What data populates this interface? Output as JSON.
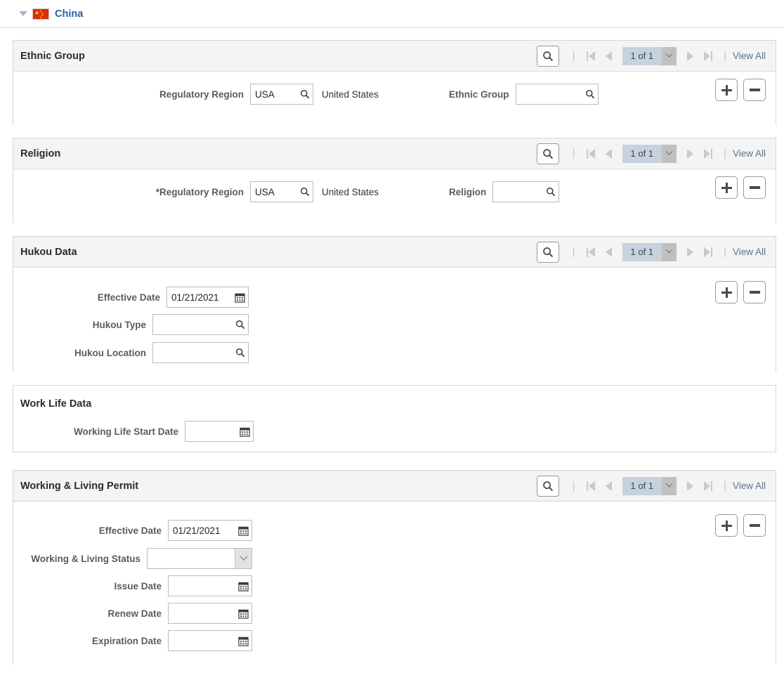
{
  "country_header": {
    "name": "China",
    "collapse_icon": "triangle-down-icon",
    "flag_icon": "china-flag-icon"
  },
  "nav_controls": {
    "search_icon": "search-icon",
    "first_icon": "first-page-icon",
    "prev_icon": "previous-page-icon",
    "next_icon": "next-page-icon",
    "last_icon": "last-page-icon",
    "counter": "1 of 1",
    "dropdown_icon": "chevron-down-icon",
    "view_all": "View All",
    "separator": "|",
    "add_icon": "plus-icon",
    "delete_icon": "minus-icon"
  },
  "sections": {
    "ethnic_group": {
      "title": "Ethnic Group",
      "counter": "1 of 1",
      "view_all": "View All",
      "regulatory_region_label": "Regulatory Region",
      "regulatory_region_value": "USA",
      "regulatory_region_description": "United States",
      "ethnic_group_label": "Ethnic Group",
      "ethnic_group_value": ""
    },
    "religion": {
      "title": "Religion",
      "counter": "1 of 1",
      "view_all": "View All",
      "regulatory_region_label": "*Regulatory Region",
      "regulatory_region_value": "USA",
      "regulatory_region_description": "United States",
      "religion_label": "Religion",
      "religion_value": ""
    },
    "hukou_data": {
      "title": "Hukou Data",
      "counter": "1 of 1",
      "view_all": "View All",
      "effective_date_label": "Effective Date",
      "effective_date_value": "01/21/2021",
      "hukou_type_label": "Hukou Type",
      "hukou_type_value": "",
      "hukou_location_label": "Hukou Location",
      "hukou_location_value": ""
    },
    "work_life_data": {
      "title": "Work Life Data",
      "working_life_start_date_label": "Working Life Start Date",
      "working_life_start_date_value": ""
    },
    "working_living_permit": {
      "title": "Working & Living Permit",
      "counter": "1 of 1",
      "view_all": "View All",
      "effective_date_label": "Effective Date",
      "effective_date_value": "01/21/2021",
      "status_label": "Working & Living Status",
      "status_value": "",
      "issue_date_label": "Issue Date",
      "issue_date_value": "",
      "renew_date_label": "Renew Date",
      "renew_date_value": "",
      "expiration_date_label": "Expiration Date",
      "expiration_date_value": ""
    }
  },
  "colors": {
    "link": "#2a62a8",
    "header_bg": "#f4f4f4",
    "counter_bg": "#c6d2de",
    "flag_red": "#de2910",
    "flag_yellow": "#ffde00"
  }
}
